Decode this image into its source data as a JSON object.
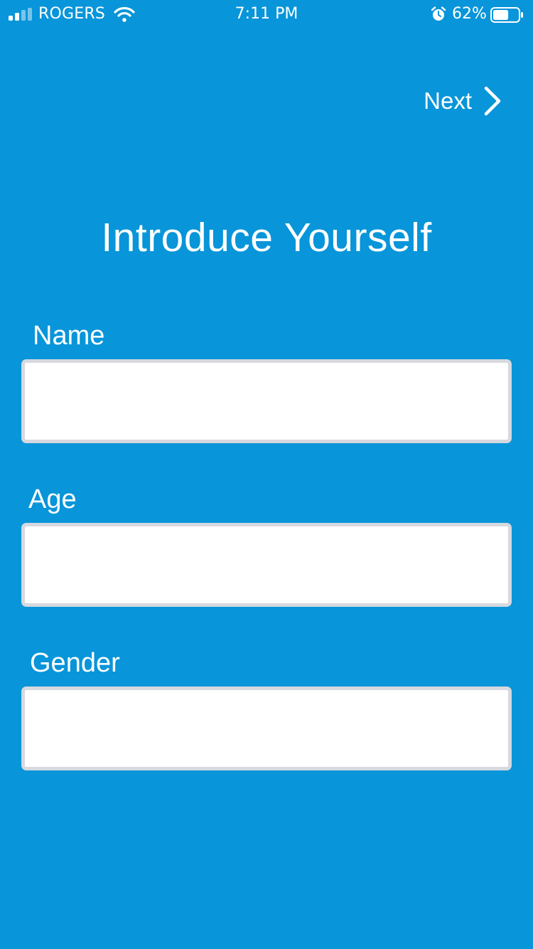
{
  "status_bar": {
    "carrier": "ROGERS",
    "time": "7:11 PM",
    "battery_percent": "62%",
    "battery_level": 0.62,
    "icons": [
      "signal-icon",
      "wifi-icon",
      "alarm-icon",
      "battery-icon"
    ]
  },
  "nav": {
    "next_label": "Next",
    "next_icon": "chevron-right-icon"
  },
  "title": "Introduce Yourself",
  "form": {
    "name": {
      "label": "Name",
      "value": ""
    },
    "age": {
      "label": "Age",
      "value": ""
    },
    "gender": {
      "label": "Gender",
      "value": ""
    }
  },
  "colors": {
    "background": "#0895d9",
    "text": "#ffffff",
    "input_background": "#ffffff",
    "input_border": "#d6d9df"
  }
}
